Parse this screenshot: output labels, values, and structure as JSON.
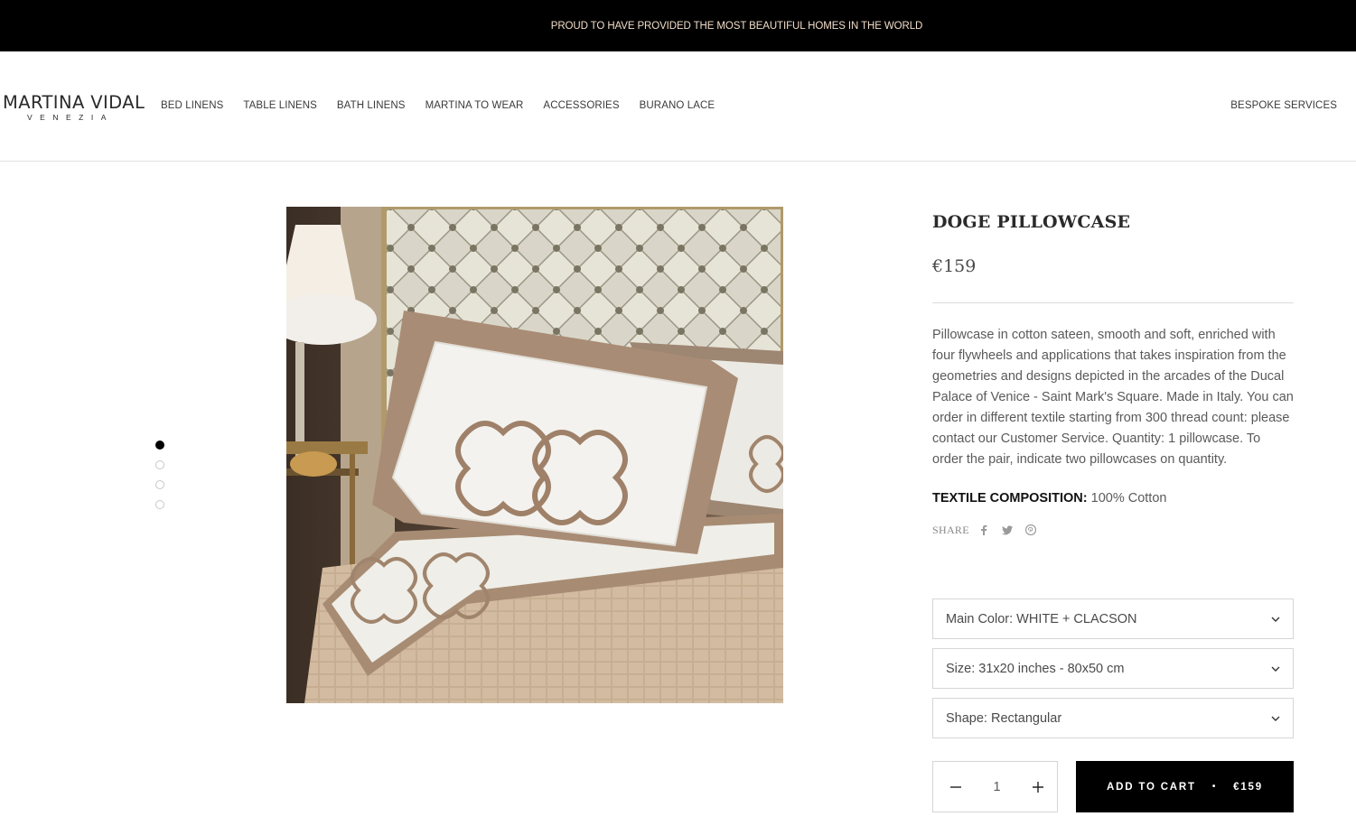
{
  "announcement": "PROUD TO HAVE PROVIDED THE MOST BEAUTIFUL HOMES IN THE WORLD",
  "logo": {
    "line1": "MARTINA VIDAL",
    "line2": "VENEZIA"
  },
  "nav": {
    "items": [
      "BED LINENS",
      "TABLE LINENS",
      "BATH LINENS",
      "MARTINA TO WEAR",
      "ACCESSORIES",
      "BURANO LACE"
    ],
    "right": "BESPOKE SERVICES"
  },
  "gallery": {
    "count": 4,
    "active": 0,
    "image": "bed-with-embroidered-pillowcase"
  },
  "product": {
    "title": "DOGE PILLOWCASE",
    "price": "€159",
    "description": "Pillowcase in cotton sateen, smooth and soft, enriched with four flywheels and applications that takes inspiration from the geometries and designs depicted in the arcades of the Ducal Palace of Venice - Saint Mark's Square. Made in Italy. You can order in different textile starting from 300 thread count: please contact our Customer Service. Quantity: 1 pillowcase. To order the pair, indicate two pillowcases on quantity.",
    "composition_label": "TEXTILE COMPOSITION:",
    "composition_value": "100% Cotton",
    "share_label": "SHARE",
    "share_icons": [
      "facebook-icon",
      "twitter-icon",
      "pinterest-icon"
    ],
    "options": {
      "color": "Main Color: WHITE + CLACSON",
      "size": "Size: 31x20 inches - 80x50 cm",
      "shape": "Shape: Rectangular"
    },
    "quantity": "1",
    "add_to_cart": "ADD TO CART",
    "add_bullet": "•",
    "cart_price": "€159"
  },
  "colors": {
    "black": "#000000",
    "announce_text": "#f0dcc8",
    "text": "#5a5a5a"
  }
}
